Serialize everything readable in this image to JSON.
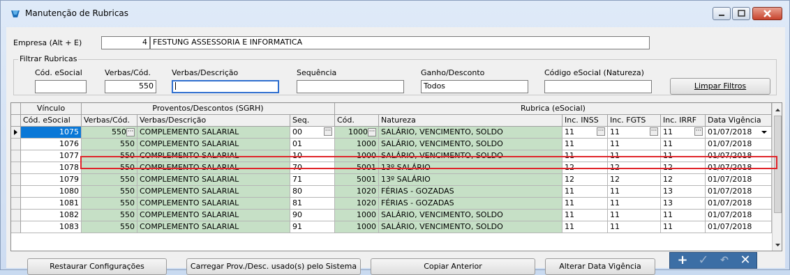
{
  "window": {
    "title": "Manutenção de Rubricas"
  },
  "empresa": {
    "label": "Empresa (Alt + E)",
    "code": "4",
    "name": "FESTUNG ASSESSORIA E INFORMATICA"
  },
  "filter": {
    "group_title": "Filtrar Rubricas",
    "labels": {
      "cod_esocial": "Cód. eSocial",
      "verbas_cod": "Verbas/Cód.",
      "verbas_desc": "Verbas/Descrição",
      "sequencia": "Sequência",
      "ganho_desconto": "Ganho/Desconto",
      "codigo_esocial_natureza": "Código eSocial (Natureza)"
    },
    "values": {
      "cod_esocial": "",
      "verbas_cod": "550",
      "verbas_desc": "",
      "sequencia": "",
      "ganho_desconto": "Todos",
      "codigo_esocial_natureza": ""
    },
    "clear_button": "Limpar Filtros"
  },
  "grid": {
    "group_headers": [
      "Vínculo",
      "Proventos/Descontos (SGRH)",
      "Rubrica (eSocial)"
    ],
    "columns": [
      "Cód. eSocial",
      "Verbas/Cód.",
      "Verbas/Descrição",
      "Seq.",
      "Cód.",
      "Natureza",
      "Inc. INSS",
      "Inc. FGTS",
      "Inc. IRRF",
      "Data Vigência"
    ],
    "rows": [
      {
        "cod_esocial": "1075",
        "verbas_cod": "550",
        "verbas_desc": "COMPLEMENTO SALARIAL",
        "seq": "00",
        "cod": "1000",
        "natureza": "SALÁRIO, VENCIMENTO, SOLDO",
        "inss": "11",
        "fgts": "11",
        "irrf": "11",
        "data": "01/07/2018"
      },
      {
        "cod_esocial": "1076",
        "verbas_cod": "550",
        "verbas_desc": "COMPLEMENTO SALARIAL",
        "seq": "01",
        "cod": "1000",
        "natureza": "SALÁRIO, VENCIMENTO, SOLDO",
        "inss": "11",
        "fgts": "11",
        "irrf": "11",
        "data": "01/07/2018"
      },
      {
        "cod_esocial": "1077",
        "verbas_cod": "550",
        "verbas_desc": "COMPLEMENTO SALARIAL",
        "seq": "10",
        "cod": "1000",
        "natureza": "SALÁRIO, VENCIMENTO, SOLDO",
        "inss": "11",
        "fgts": "11",
        "irrf": "11",
        "data": "01/07/2018"
      },
      {
        "cod_esocial": "1078",
        "verbas_cod": "550",
        "verbas_desc": "COMPLEMENTO SALARIAL",
        "seq": "70",
        "cod": "5001",
        "natureza": "13º SALÁRIO",
        "inss": "12",
        "fgts": "12",
        "irrf": "12",
        "data": "01/07/2018"
      },
      {
        "cod_esocial": "1079",
        "verbas_cod": "550",
        "verbas_desc": "COMPLEMENTO SALARIAL",
        "seq": "71",
        "cod": "5001",
        "natureza": "13º SALÁRIO",
        "inss": "12",
        "fgts": "12",
        "irrf": "12",
        "data": "01/07/2018"
      },
      {
        "cod_esocial": "1080",
        "verbas_cod": "550",
        "verbas_desc": "COMPLEMENTO SALARIAL",
        "seq": "80",
        "cod": "1020",
        "natureza": "FÉRIAS - GOZADAS",
        "inss": "11",
        "fgts": "11",
        "irrf": "13",
        "data": "01/07/2018"
      },
      {
        "cod_esocial": "1081",
        "verbas_cod": "550",
        "verbas_desc": "COMPLEMENTO SALARIAL",
        "seq": "81",
        "cod": "1020",
        "natureza": "FÉRIAS - GOZADAS",
        "inss": "11",
        "fgts": "11",
        "irrf": "13",
        "data": "01/07/2018"
      },
      {
        "cod_esocial": "1082",
        "verbas_cod": "550",
        "verbas_desc": "COMPLEMENTO SALARIAL",
        "seq": "90",
        "cod": "1000",
        "natureza": "SALÁRIO, VENCIMENTO, SOLDO",
        "inss": "11",
        "fgts": "11",
        "irrf": "11",
        "data": "01/07/2018"
      },
      {
        "cod_esocial": "1083",
        "verbas_cod": "550",
        "verbas_desc": "COMPLEMENTO SALARIAL",
        "seq": "91",
        "cod": "1000",
        "natureza": "SALÁRIO, VENCIMENTO, SOLDO",
        "inss": "11",
        "fgts": "11",
        "irrf": "11",
        "data": "01/07/2018"
      }
    ]
  },
  "buttons": {
    "restaurar": "Restaurar Configurações",
    "carregar": "Carregar Prov./Desc. usado(s) pelo Sistema",
    "copiar": "Copiar Anterior",
    "alterar": "Alterar Data Vigência"
  },
  "toolbar": {
    "add_icon": "plus-icon",
    "confirm_icon": "check-icon",
    "undo_icon": "undo-icon",
    "cancel_icon": "x-icon"
  },
  "colors": {
    "green_cells": "#c6e0c6",
    "selection": "#0a78d7",
    "highlight": "#e0242a"
  }
}
